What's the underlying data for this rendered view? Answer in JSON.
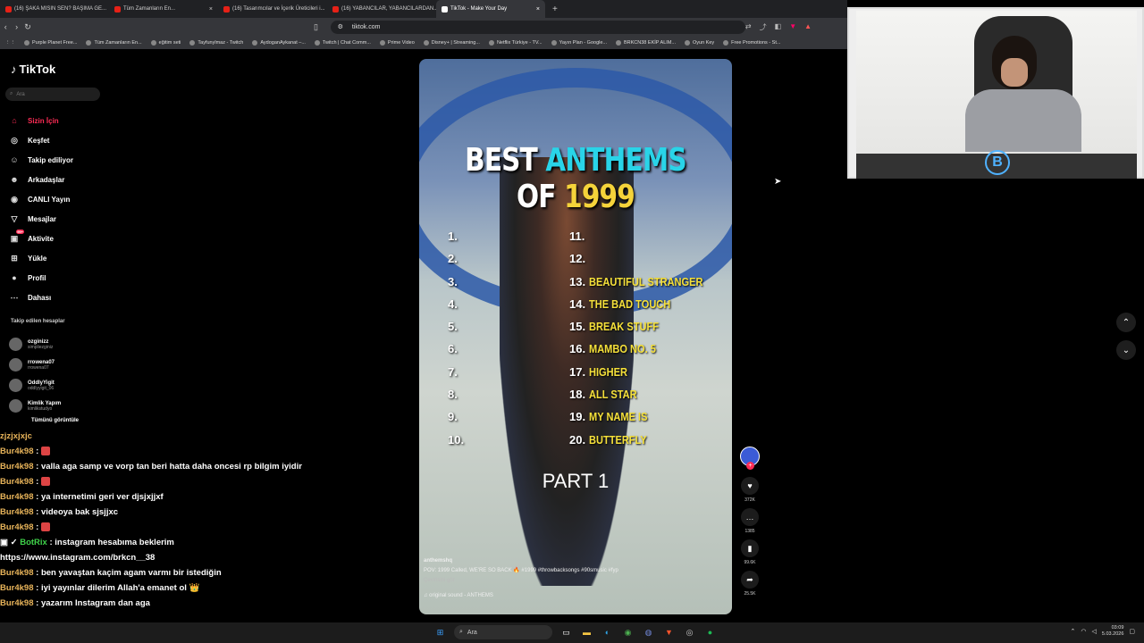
{
  "browser": {
    "tabs": [
      {
        "title": "(16) ŞAKA MISIN SEN? BAŞIMA GE..."
      },
      {
        "title": "Tüm Zamanların En..."
      },
      {
        "title": "(16) Tasarımcılar ve İçerik Üreticileri i..."
      },
      {
        "title": "(16) YABANCILAR, YABANCILARDAN..."
      },
      {
        "title": "TikTok - Make Your Day",
        "active": true
      }
    ],
    "url": "tiktok.com",
    "bookmarks": [
      "Purple Planet Free...",
      "Tüm Zamanların En...",
      "eğitim seti",
      "Tayfunylmaz - Twitch",
      "AydoganAykanat –...",
      "Twitch | Chat Comm...",
      "Prime Video",
      "Disney+ | Streaming...",
      "Netflix Türkiye - TV...",
      "Yayın Plan - Google...",
      "BRKCN38 EKİP ALIM...",
      "Oyun Key",
      "Free Promotions - St..."
    ]
  },
  "tiktok": {
    "logo": "TikTok",
    "search_placeholder": "Ara",
    "menu": [
      {
        "label": "Sizin İçin",
        "icon": "home-icon",
        "active": true
      },
      {
        "label": "Keşfet",
        "icon": "compass-icon"
      },
      {
        "label": "Takip ediliyor",
        "icon": "following-icon"
      },
      {
        "label": "Arkadaşlar",
        "icon": "friends-icon"
      },
      {
        "label": "CANLI Yayın",
        "icon": "live-icon"
      },
      {
        "label": "Mesajlar",
        "icon": "messages-icon"
      },
      {
        "label": "Aktivite",
        "icon": "activity-icon",
        "badge": "99+"
      },
      {
        "label": "Yükle",
        "icon": "upload-icon"
      },
      {
        "label": "Profil",
        "icon": "profile-icon"
      },
      {
        "label": "Dahası",
        "icon": "more-icon"
      }
    ],
    "following_heading": "Takip edilen hesaplar",
    "following": [
      {
        "name": "ozginizz",
        "sub": "simpliezginiz"
      },
      {
        "name": "rrowena07",
        "sub": "rrowena07"
      },
      {
        "name": "OddlyYigit",
        "sub": "oddlyyigit_06"
      },
      {
        "name": "Kimlik Yapım",
        "sub": "kimlikstudyo"
      }
    ],
    "see_all": "Tümünü görüntüle"
  },
  "video": {
    "title_parts": [
      "BEST ",
      "ANTHEMS",
      " OF ",
      "1999"
    ],
    "numbers_left": [
      "1.",
      "2.",
      "3.",
      "4.",
      "5.",
      "6.",
      "7.",
      "8.",
      "9.",
      "10."
    ],
    "songs_right": [
      {
        "n": "11.",
        "song": ""
      },
      {
        "n": "12.",
        "song": ""
      },
      {
        "n": "13.",
        "song": "BEAUTIFUL STRANGER"
      },
      {
        "n": "14.",
        "song": "THE BAD TOUCH"
      },
      {
        "n": "15.",
        "song": "BREAK STUFF"
      },
      {
        "n": "16.",
        "song": "MAMBO NO. 5"
      },
      {
        "n": "17.",
        "song": "HIGHER"
      },
      {
        "n": "18.",
        "song": "ALL STAR"
      },
      {
        "n": "19.",
        "song": "MY NAME IS"
      },
      {
        "n": "20.",
        "song": "BUTTERFLY"
      }
    ],
    "part": "PART 1",
    "author": "anthemshq",
    "caption": "POV: 1999 Called, WE'RE SO BACK 🔥 #1999 #throwbacksongs #90smusic #fyp",
    "translate": "Çevirisini gör",
    "sound": "♫ original sound - ANTHEMS"
  },
  "actions": {
    "likes": "372K",
    "comments": "1385",
    "saves": "99.6K",
    "shares": "25.5K",
    "avatar_label": "ANTHEMS"
  },
  "chat": [
    {
      "user": "zjzjxjxjc",
      "msg": "",
      "solo": true
    },
    {
      "user": "Bur4k98",
      "msg": ""
    },
    {
      "user": "Bur4k98",
      "msg": "valla aga samp ve vorp tan beri hatta daha oncesi rp bilgim iyidir"
    },
    {
      "user": "Bur4k98",
      "msg": ""
    },
    {
      "user": "Bur4k98",
      "msg": "ya internetimi geri ver djsjxjjxf"
    },
    {
      "user": "Bur4k98",
      "msg": "videoya bak sjsjjxc"
    },
    {
      "user": "Bur4k98",
      "msg": ""
    },
    {
      "user": "BotRix",
      "msg": "instagram hesabıma beklerim https://www.instagram.com/brkcn__38",
      "bot": true
    },
    {
      "user": "Bur4k98",
      "msg": "ben yavaştan kaçim agam varmı bir istediğin"
    },
    {
      "user": "Bur4k98",
      "msg": "iyi yayınlar dilerim Allah'a emanet ol 👑"
    },
    {
      "user": "Bur4k98",
      "msg": "yazarım Instagram dan aga"
    }
  ],
  "taskbar": {
    "search": "Ara",
    "time": "03:09",
    "date": "5.03.2026"
  },
  "colors": {
    "tiktok_accent": "#fe2c55",
    "title_cyan": "#29d4e8",
    "title_yellow": "#f5d33a",
    "chat_user": "#e8b45a"
  }
}
